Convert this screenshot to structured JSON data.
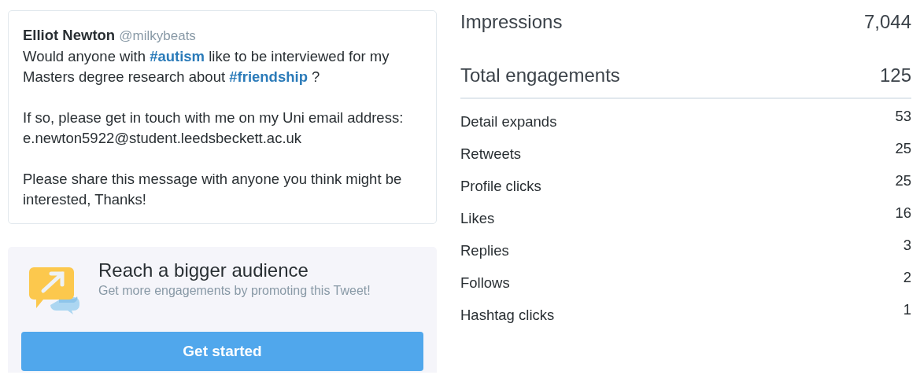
{
  "tweet": {
    "author": "Elliot Newton",
    "handle": "@milkybeats",
    "paragraphs": [
      [
        {
          "text": "Would anyone with "
        },
        {
          "text": "#autism",
          "kind": "hashtag"
        },
        {
          "text": " like to be interviewed for my Masters degree research about "
        },
        {
          "text": "#friendship",
          "kind": "hashtag"
        },
        {
          "text": " ?"
        }
      ],
      [
        {
          "text": "If so, please get in touch with me on my Uni email address: e.newton5922@student.leedsbeckett.ac.uk"
        }
      ],
      [
        {
          "text": "Please share this message with anyone you think might be interested, Thanks!"
        }
      ]
    ]
  },
  "promo": {
    "title": "Reach a bigger audience",
    "subtitle": "Get more engagements by promoting this Tweet!",
    "button": "Get started"
  },
  "summary": [
    {
      "label": "Impressions",
      "value": "7,044"
    },
    {
      "label": "Total engagements",
      "value": "125"
    }
  ],
  "metrics": [
    {
      "label": "Detail expands",
      "value": "53"
    },
    {
      "label": "Retweets",
      "value": "25"
    },
    {
      "label": "Profile clicks",
      "value": "25"
    },
    {
      "label": "Likes",
      "value": "16"
    },
    {
      "label": "Replies",
      "value": "3"
    },
    {
      "label": "Follows",
      "value": "2"
    },
    {
      "label": "Hashtag clicks",
      "value": "1"
    }
  ]
}
